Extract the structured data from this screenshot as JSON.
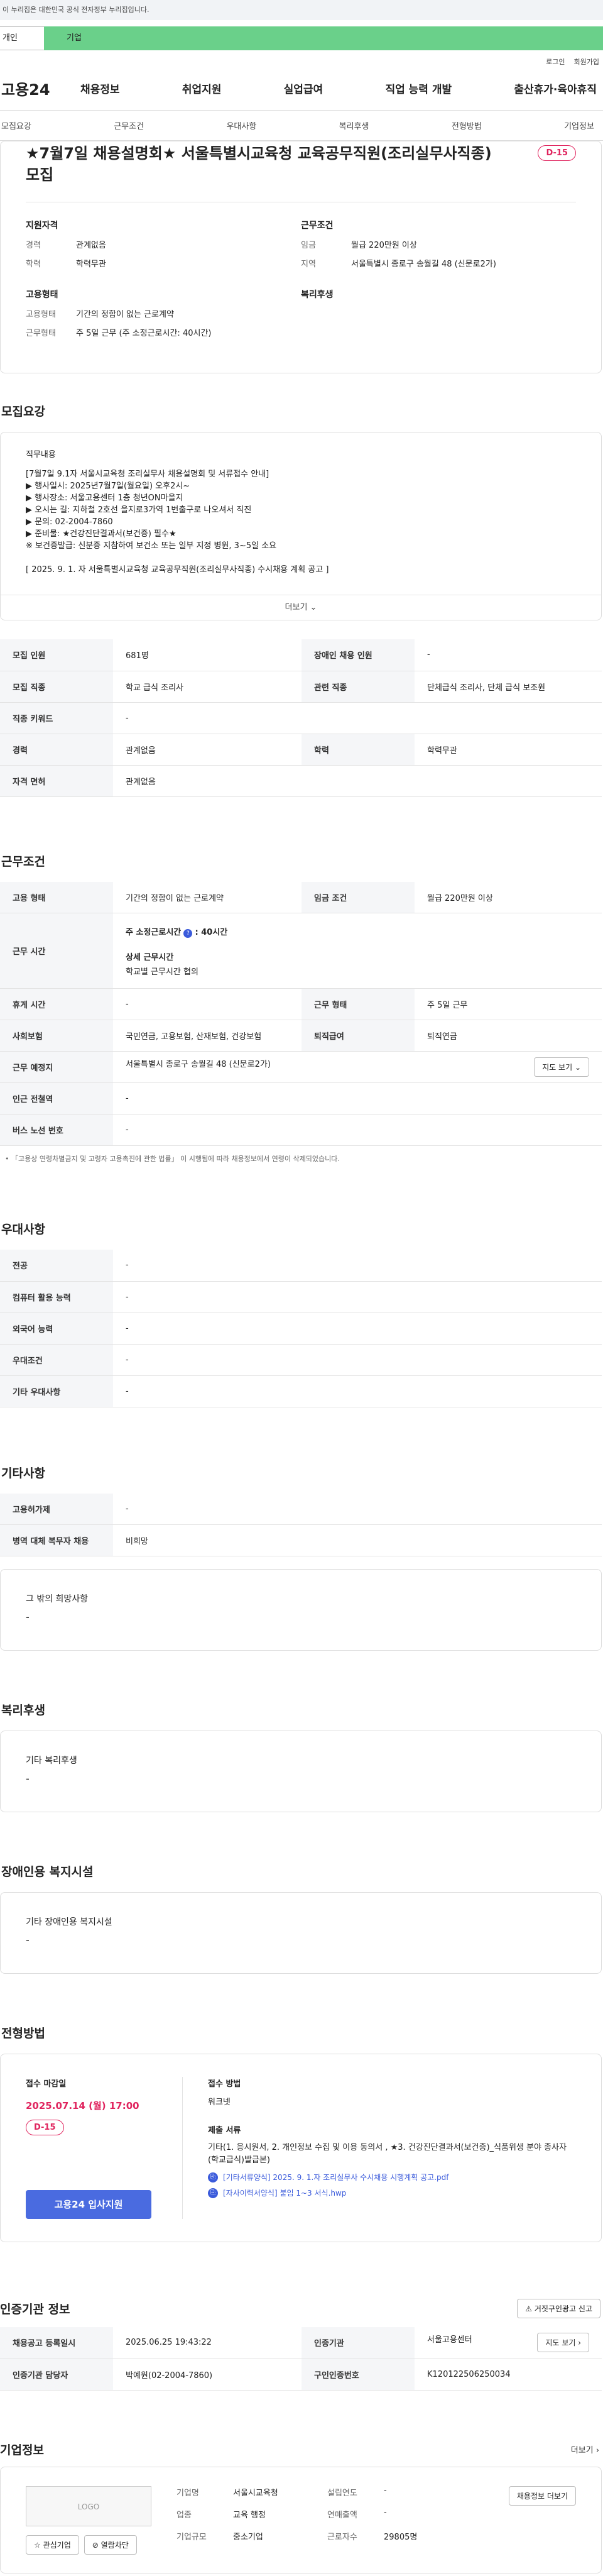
{
  "gov_banner": "이 누리집은 대한민국 공식 전자정부 누리집입니다.",
  "tabs": {
    "t1": "개인",
    "t2": "기업"
  },
  "util": {
    "login": "로그인",
    "join": "회원가입"
  },
  "gnb": {
    "logo": "고용24",
    "menu": [
      "채용정보",
      "취업지원",
      "실업급여",
      "직업 능력 개발",
      "출산휴가·육아휴직"
    ]
  },
  "anchor": [
    "모집요강",
    "근무조건",
    "우대사항",
    "복리후생",
    "전형방법",
    "기업정보"
  ],
  "header": {
    "title": "★7월7일 채용설명회★ 서울특별시교육청 교육공무직원(조리실무사직종) 모집",
    "dday": "D-15",
    "qual_title": "지원자격",
    "career_k": "경력",
    "career_v": "관계없음",
    "edu_k": "학력",
    "edu_v": "학력무관",
    "cond_title": "근무조건",
    "wage_k": "임금",
    "wage_v": "월급 220만원 이상",
    "area_k": "지역",
    "area_v": "서울특별시 종로구 송월길 48 (신문로2가)",
    "emp_title": "고용형태",
    "emptype_k": "고용형태",
    "emptype_v": "기간의 정함이 없는 근로계약",
    "worktype_k": "근무형태",
    "worktype_v": "주 5일 근무 (주 소정근로시간: 40시간)",
    "welfare_title": "복리후생"
  },
  "recruit": {
    "section": "모집요강",
    "job_title": "직무내용",
    "job_text": "[7월7일 9.1자 서울시교육청 조리실무사 채용설명회 및 서류접수 안내]\n▶ 행사일시: 2025년7월7일(월요일) 오후2시~\n▶ 행사장소: 서울고용센터 1층 청년ON마을지\n▶ 오시는 길: 지하철 2호선 을지로3가역 1번출구로 나오셔서 직진\n▶ 문의: 02-2004-7860\n▶ 준비물: ★건강진단결과서(보건증) 필수★\n※ 보건증발급: 신분증 지참하여 보건소 또는 일부 지정 병원, 3~5일 소요\n\n[ 2025. 9. 1. 자 서울특별시교육청 교육공무직원(조리실무사직종) 수시채용 계획 공고 ]",
    "more": "더보기",
    "rows": [
      [
        "모집 인원",
        "681명",
        "장애인 채용 인원",
        "-"
      ],
      [
        "모집 직종",
        "학교 급식 조리사",
        "관련 직종",
        "단체급식 조리사, 단체 급식 보조원"
      ],
      [
        "직종 키워드",
        "-",
        "",
        ""
      ],
      [
        "경력",
        "관계없음",
        "학력",
        "학력무관"
      ],
      [
        "자격 면허",
        "관계없음",
        "",
        ""
      ]
    ]
  },
  "work": {
    "section": "근무조건",
    "emp_k": "고용 형태",
    "emp_v": "기간의 정함이 없는 근로계약",
    "wage_k": "임금 조건",
    "wage_v": "월급 220만원 이상",
    "hours_k": "근무 시간",
    "hours_main": "주 소정근로시간",
    "hours_val": ": 40시간",
    "hours_detail": "상세 근무시간",
    "hours_detail_v": "학교별 근무시간 협의",
    "rest_k": "휴게 시간",
    "rest_v": "-",
    "form_k": "근무 형태",
    "form_v": "주 5일 근무",
    "ins_k": "사회보험",
    "ins_v": "국민연금, 고용보험, 산재보험, 건강보험",
    "ret_k": "퇴직급여",
    "ret_v": "퇴직연금",
    "place_k": "근무 예정지",
    "place_v": "서울특별시 종로구 송월길 48 (신문로2가)",
    "map_btn": "지도 보기",
    "subway_k": "인근 전철역",
    "subway_v": "-",
    "bus_k": "버스 노선 번호",
    "bus_v": "-",
    "note": "「고용상 연령차별금지 및 고령자 고용촉진에 관한 법률」 이 시행됨에 따라 채용정보에서 연령이 삭제되었습니다."
  },
  "pref": {
    "section": "우대사항",
    "rows": [
      [
        "전공",
        "-"
      ],
      [
        "컴퓨터 활용 능력",
        "-"
      ],
      [
        "외국어 능력",
        "-"
      ],
      [
        "우대조건",
        "-"
      ],
      [
        "기타 우대사항",
        "-"
      ]
    ]
  },
  "etc": {
    "section": "기타사항",
    "rows": [
      [
        "고용허가제",
        "-"
      ],
      [
        "병역 대체 복무자 채용",
        "비희망"
      ]
    ],
    "other_t": "그 밖의 희망사항",
    "other_v": "-"
  },
  "welfare": {
    "section": "복리후생",
    "t": "기타 복리후생",
    "v": "-"
  },
  "disabled": {
    "section": "장애인용 복지시설",
    "t": "기타 장애인용 복지시설",
    "v": "-"
  },
  "process": {
    "section": "전형방법",
    "deadline_t": "접수 마감일",
    "deadline_v": "2025.07.14 (월) 17:00",
    "dday": "D-15",
    "apply": "고용24 입사지원",
    "method_t": "접수 방법",
    "method_v": "워크넷",
    "docs_t": "제출 서류",
    "docs_v": "기타(1. 응시원서, 2. 개인정보 수집 및 이용 동의서 , ★3. 건강진단결과서(보건증)_식품위생 분야 종사자(학교급식)발급본)",
    "file1": "[기타서류양식] 2025. 9. 1.자 조리실무사 수시채용 시행계획 공고.pdf",
    "file2": "[자사이력서양식] 붙임 1~3 서식.hwp"
  },
  "cert": {
    "section": "인증기관 정보",
    "report": "거짓구인광고 신고",
    "reg_k": "채용공고 등록일시",
    "reg_v": "2025.06.25 19:43:22",
    "org_k": "인증기관",
    "org_v": "서울고용센터",
    "map_btn": "지도 보기",
    "mgr_k": "인증기관 담당자",
    "mgr_v": "박예원(02-2004-7860)",
    "no_k": "구인인증번호",
    "no_v": "K120122506250034"
  },
  "company": {
    "section": "기업정보",
    "more": "더보기",
    "logo": "LOGO",
    "fav": "관심기업",
    "block": "열람차단",
    "name_k": "기업명",
    "name_v": "서울시교육청",
    "est_k": "설립연도",
    "est_v": "-",
    "list_btn": "채용정보 더보기",
    "ind_k": "업종",
    "ind_v": "교육 행정",
    "sales_k": "연매출액",
    "sales_v": "-",
    "size_k": "기업규모",
    "size_v": "중소기업",
    "emp_k": "근로자수",
    "emp_v": "29805명"
  }
}
